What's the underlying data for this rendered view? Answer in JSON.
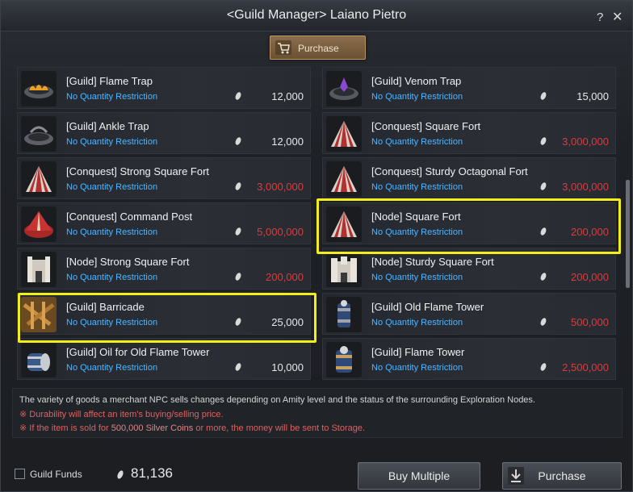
{
  "window": {
    "title": "<Guild Manager> Laiano Pietro",
    "help": "?",
    "close": "✕"
  },
  "tab": {
    "label": "Purchase",
    "icon": "cart-icon"
  },
  "items": [
    {
      "name": "[Guild] Flame Trap",
      "qty": "No Quantity Restriction",
      "price": "12,000",
      "red": false,
      "icon": "flame-trap-icon"
    },
    {
      "name": "[Guild] Venom Trap",
      "qty": "No Quantity Restriction",
      "price": "15,000",
      "red": false,
      "icon": "venom-trap-icon"
    },
    {
      "name": "[Guild] Ankle Trap",
      "qty": "No Quantity Restriction",
      "price": "12,000",
      "red": false,
      "icon": "ankle-trap-icon"
    },
    {
      "name": "[Conquest] Square Fort",
      "qty": "No Quantity Restriction",
      "price": "3,000,000",
      "red": true,
      "icon": "tent-icon"
    },
    {
      "name": "[Conquest] Strong Square Fort",
      "qty": "No Quantity Restriction",
      "price": "3,000,000",
      "red": true,
      "icon": "tent-icon"
    },
    {
      "name": "[Conquest] Sturdy Octagonal Fort",
      "qty": "No Quantity Restriction",
      "price": "3,000,000",
      "red": true,
      "icon": "tent-icon"
    },
    {
      "name": "[Conquest] Command Post",
      "qty": "No Quantity Restriction",
      "price": "5,000,000",
      "red": true,
      "icon": "command-post-icon"
    },
    {
      "name": "[Node] Square Fort",
      "qty": "No Quantity Restriction",
      "price": "200,000",
      "red": true,
      "icon": "tent-icon"
    },
    {
      "name": "[Node] Strong Square Fort",
      "qty": "No Quantity Restriction",
      "price": "200,000",
      "red": true,
      "icon": "fort-icon"
    },
    {
      "name": "[Node] Sturdy Square Fort",
      "qty": "No Quantity Restriction",
      "price": "200,000",
      "red": true,
      "icon": "fort-icon"
    },
    {
      "name": "[Guild] Barricade",
      "qty": "No Quantity Restriction",
      "price": "25,000",
      "red": false,
      "icon": "barricade-icon"
    },
    {
      "name": "[Guild] Old Flame Tower",
      "qty": "No Quantity Restriction",
      "price": "500,000",
      "red": true,
      "icon": "flame-tower-icon"
    },
    {
      "name": "[Guild] Oil for Old Flame Tower",
      "qty": "No Quantity Restriction",
      "price": "10,000",
      "red": false,
      "icon": "oil-barrel-icon"
    },
    {
      "name": "[Guild] Flame Tower",
      "qty": "No Quantity Restriction",
      "price": "2,500,000",
      "red": true,
      "icon": "flame-tower-icon"
    }
  ],
  "info": {
    "line1": "The variety of goods a merchant NPC sells changes depending on Amity level and the status of the surrounding Exploration Nodes.",
    "line2": "※ Durability will affect an item's buying/selling price.",
    "line3_pre": "※ If the item is sold for ",
    "line3_amount": "500,000 Silver Coins",
    "line3_post": " or more, the money will be sent to Storage."
  },
  "footer": {
    "guild_funds_label": "Guild Funds",
    "funds": "81,136",
    "buy_multiple": "Buy Multiple",
    "purchase": "Purchase"
  },
  "colors": {
    "accent_blue": "#4db6ff",
    "price_red": "#d83c3c",
    "highlight": "#f2ee1c"
  }
}
